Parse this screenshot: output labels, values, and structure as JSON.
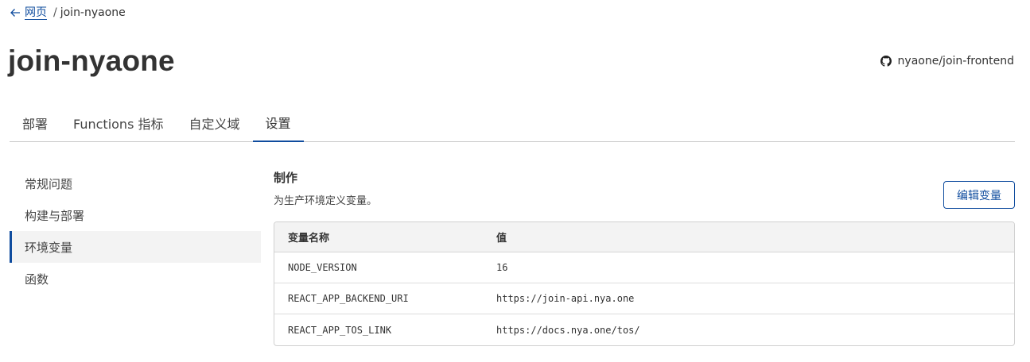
{
  "breadcrumb": {
    "back_label": "网页",
    "separator": "/",
    "current": "join-nyaone"
  },
  "page": {
    "title": "join-nyaone",
    "repo": "nyaone/join-frontend"
  },
  "tabs": [
    {
      "label": "部署",
      "active": false
    },
    {
      "label": "Functions 指标",
      "active": false
    },
    {
      "label": "自定义域",
      "active": false
    },
    {
      "label": "设置",
      "active": true
    }
  ],
  "sidebar": {
    "items": [
      {
        "label": "常规问题",
        "active": false
      },
      {
        "label": "构建与部署",
        "active": false
      },
      {
        "label": "环境变量",
        "active": true
      },
      {
        "label": "函数",
        "active": false
      }
    ]
  },
  "section": {
    "title": "制作",
    "description": "为生产环境定义变量。",
    "edit_button": "编辑变量"
  },
  "table": {
    "headers": {
      "name": "变量名称",
      "value": "值"
    },
    "rows": [
      {
        "name": "NODE_VERSION",
        "value": "16"
      },
      {
        "name": "REACT_APP_BACKEND_URI",
        "value": "https://join-api.nya.one"
      },
      {
        "name": "REACT_APP_TOS_LINK",
        "value": "https://docs.nya.one/tos/"
      }
    ]
  },
  "colors": {
    "accent": "#0f4c9e",
    "text": "#333333",
    "header_bg": "#f3f3f3"
  }
}
